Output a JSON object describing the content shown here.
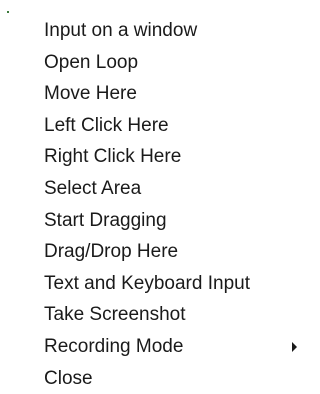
{
  "menu": {
    "items": [
      {
        "label": "Input on a window"
      },
      {
        "label": "Open Loop"
      },
      {
        "label": "Move Here"
      },
      {
        "label": "Left Click Here"
      },
      {
        "label": "Right Click Here"
      },
      {
        "label": "Select Area"
      },
      {
        "label": "Start Dragging"
      },
      {
        "label": "Drag/Drop Here"
      },
      {
        "label": "Text and Keyboard Input"
      },
      {
        "label": "Take Screenshot"
      },
      {
        "label": "Recording Mode",
        "submenu_icon": "submenu-arrow-icon"
      },
      {
        "label": "Close"
      }
    ]
  }
}
